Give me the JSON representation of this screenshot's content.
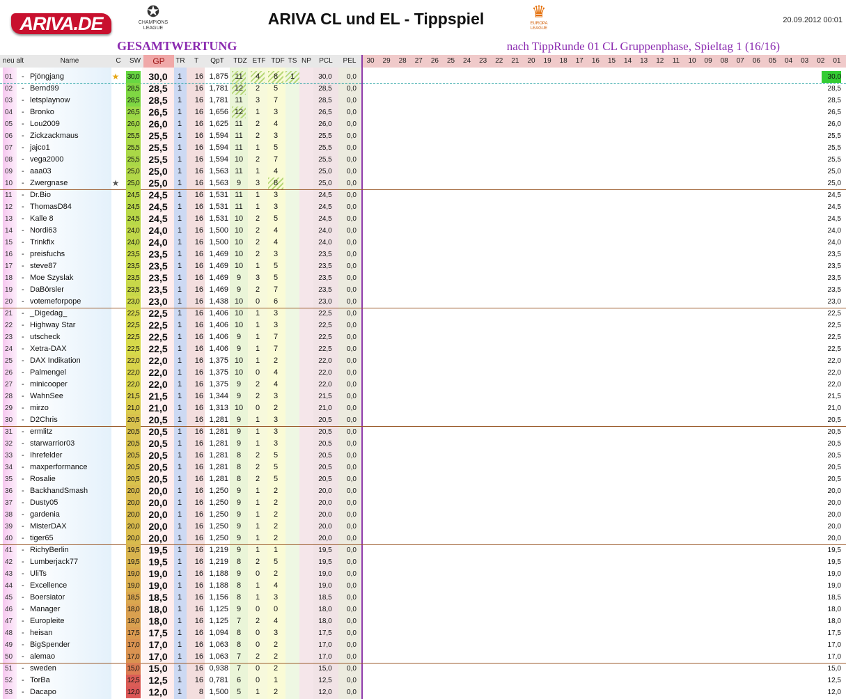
{
  "header": {
    "logo_text": "ARIVA.DE",
    "cl_logo_text": "CHAMPIONS LEAGUE",
    "el_logo_text": "EUROPA LEAGUE",
    "title": "ARIVA CL und EL - Tippspiel",
    "timestamp": "20.09.2012 00:01",
    "section": "GESAMTWERTUNG",
    "subtitle": "nach TippRunde 01 CL Gruppenphase, Spieltag 1 (16/16)"
  },
  "columns": {
    "neu_alt": "neu alt",
    "name": "Name",
    "c": "C",
    "sw": "SW",
    "gp": "GP",
    "tr": "TR",
    "t": "T",
    "qpt": "QpT",
    "tdz": "TDZ",
    "etf": "ETF",
    "tdf": "TDF",
    "ts": "TS",
    "np": "NP",
    "pcl": "PCL",
    "pel": "PEL",
    "rounds": [
      "30",
      "29",
      "28",
      "27",
      "26",
      "25",
      "24",
      "23",
      "22",
      "21",
      "20",
      "19",
      "18",
      "17",
      "16",
      "15",
      "14",
      "13",
      "12",
      "11",
      "10",
      "09",
      "08",
      "07",
      "06",
      "05",
      "04",
      "03",
      "02",
      "01"
    ]
  },
  "colors": {
    "accent_purple": "#8b2bb0",
    "logo_red": "#c8102e",
    "highlight_green": "#33cc33"
  },
  "rows": [
    {
      "rank": "01",
      "alt": "-",
      "name": "Pjöngjang",
      "star": "★",
      "sw": "30,0",
      "gp": "30,0",
      "tr": "1",
      "t": "16",
      "qpt": "1,875",
      "tdz": "11",
      "etf": "4",
      "tdf": "8",
      "ts": "1",
      "pcl": "30,0",
      "pel": "0,0",
      "r01": "30,0"
    },
    {
      "rank": "02",
      "alt": "-",
      "name": "Bernd99",
      "star": "",
      "sw": "28,5",
      "gp": "28,5",
      "tr": "1",
      "t": "16",
      "qpt": "1,781",
      "tdz": "12",
      "etf": "2",
      "tdf": "5",
      "ts": "",
      "pcl": "28,5",
      "pel": "0,0",
      "r01": "28,5"
    },
    {
      "rank": "03",
      "alt": "-",
      "name": "letsplaynow",
      "star": "",
      "sw": "28,5",
      "gp": "28,5",
      "tr": "1",
      "t": "16",
      "qpt": "1,781",
      "tdz": "11",
      "etf": "3",
      "tdf": "7",
      "ts": "",
      "pcl": "28,5",
      "pel": "0,0",
      "r01": "28,5"
    },
    {
      "rank": "04",
      "alt": "-",
      "name": "Bronko",
      "star": "",
      "sw": "26,5",
      "gp": "26,5",
      "tr": "1",
      "t": "16",
      "qpt": "1,656",
      "tdz": "12",
      "etf": "1",
      "tdf": "3",
      "ts": "",
      "pcl": "26,5",
      "pel": "0,0",
      "r01": "26,5"
    },
    {
      "rank": "05",
      "alt": "-",
      "name": "Lou2009",
      "star": "",
      "sw": "26,0",
      "gp": "26,0",
      "tr": "1",
      "t": "16",
      "qpt": "1,625",
      "tdz": "11",
      "etf": "2",
      "tdf": "4",
      "ts": "",
      "pcl": "26,0",
      "pel": "0,0",
      "r01": "26,0"
    },
    {
      "rank": "06",
      "alt": "-",
      "name": "Zickzackmaus",
      "star": "",
      "sw": "25,5",
      "gp": "25,5",
      "tr": "1",
      "t": "16",
      "qpt": "1,594",
      "tdz": "11",
      "etf": "2",
      "tdf": "3",
      "ts": "",
      "pcl": "25,5",
      "pel": "0,0",
      "r01": "25,5"
    },
    {
      "rank": "07",
      "alt": "-",
      "name": "jajco1",
      "star": "",
      "sw": "25,5",
      "gp": "25,5",
      "tr": "1",
      "t": "16",
      "qpt": "1,594",
      "tdz": "11",
      "etf": "1",
      "tdf": "5",
      "ts": "",
      "pcl": "25,5",
      "pel": "0,0",
      "r01": "25,5"
    },
    {
      "rank": "08",
      "alt": "-",
      "name": "vega2000",
      "star": "",
      "sw": "25,5",
      "gp": "25,5",
      "tr": "1",
      "t": "16",
      "qpt": "1,594",
      "tdz": "10",
      "etf": "2",
      "tdf": "7",
      "ts": "",
      "pcl": "25,5",
      "pel": "0,0",
      "r01": "25,5"
    },
    {
      "rank": "09",
      "alt": "-",
      "name": "aaa03",
      "star": "",
      "sw": "25,0",
      "gp": "25,0",
      "tr": "1",
      "t": "16",
      "qpt": "1,563",
      "tdz": "11",
      "etf": "1",
      "tdf": "4",
      "ts": "",
      "pcl": "25,0",
      "pel": "0,0",
      "r01": "25,0"
    },
    {
      "rank": "10",
      "alt": "-",
      "name": "Zwergnase",
      "star": "★",
      "sw": "25,0",
      "gp": "25,0",
      "tr": "1",
      "t": "16",
      "qpt": "1,563",
      "tdz": "9",
      "etf": "3",
      "tdf": "8",
      "ts": "",
      "pcl": "25,0",
      "pel": "0,0",
      "r01": "25,0"
    },
    {
      "rank": "11",
      "alt": "-",
      "name": "Dr.Bio",
      "star": "",
      "sw": "24,5",
      "gp": "24,5",
      "tr": "1",
      "t": "16",
      "qpt": "1,531",
      "tdz": "11",
      "etf": "1",
      "tdf": "3",
      "ts": "",
      "pcl": "24,5",
      "pel": "0,0",
      "r01": "24,5"
    },
    {
      "rank": "12",
      "alt": "-",
      "name": "ThomasD84",
      "star": "",
      "sw": "24,5",
      "gp": "24,5",
      "tr": "1",
      "t": "16",
      "qpt": "1,531",
      "tdz": "11",
      "etf": "1",
      "tdf": "3",
      "ts": "",
      "pcl": "24,5",
      "pel": "0,0",
      "r01": "24,5"
    },
    {
      "rank": "13",
      "alt": "-",
      "name": "Kalle 8",
      "star": "",
      "sw": "24,5",
      "gp": "24,5",
      "tr": "1",
      "t": "16",
      "qpt": "1,531",
      "tdz": "10",
      "etf": "2",
      "tdf": "5",
      "ts": "",
      "pcl": "24,5",
      "pel": "0,0",
      "r01": "24,5"
    },
    {
      "rank": "14",
      "alt": "-",
      "name": "Nordi63",
      "star": "",
      "sw": "24,0",
      "gp": "24,0",
      "tr": "1",
      "t": "16",
      "qpt": "1,500",
      "tdz": "10",
      "etf": "2",
      "tdf": "4",
      "ts": "",
      "pcl": "24,0",
      "pel": "0,0",
      "r01": "24,0"
    },
    {
      "rank": "15",
      "alt": "-",
      "name": "Trinkfix",
      "star": "",
      "sw": "24,0",
      "gp": "24,0",
      "tr": "1",
      "t": "16",
      "qpt": "1,500",
      "tdz": "10",
      "etf": "2",
      "tdf": "4",
      "ts": "",
      "pcl": "24,0",
      "pel": "0,0",
      "r01": "24,0"
    },
    {
      "rank": "16",
      "alt": "-",
      "name": "preisfuchs",
      "star": "",
      "sw": "23,5",
      "gp": "23,5",
      "tr": "1",
      "t": "16",
      "qpt": "1,469",
      "tdz": "10",
      "etf": "2",
      "tdf": "3",
      "ts": "",
      "pcl": "23,5",
      "pel": "0,0",
      "r01": "23,5"
    },
    {
      "rank": "17",
      "alt": "-",
      "name": "steve87",
      "star": "",
      "sw": "23,5",
      "gp": "23,5",
      "tr": "1",
      "t": "16",
      "qpt": "1,469",
      "tdz": "10",
      "etf": "1",
      "tdf": "5",
      "ts": "",
      "pcl": "23,5",
      "pel": "0,0",
      "r01": "23,5"
    },
    {
      "rank": "18",
      "alt": "-",
      "name": "Moe Szyslak",
      "star": "",
      "sw": "23,5",
      "gp": "23,5",
      "tr": "1",
      "t": "16",
      "qpt": "1,469",
      "tdz": "9",
      "etf": "3",
      "tdf": "5",
      "ts": "",
      "pcl": "23,5",
      "pel": "0,0",
      "r01": "23,5"
    },
    {
      "rank": "19",
      "alt": "-",
      "name": "DaBörsler",
      "star": "",
      "sw": "23,5",
      "gp": "23,5",
      "tr": "1",
      "t": "16",
      "qpt": "1,469",
      "tdz": "9",
      "etf": "2",
      "tdf": "7",
      "ts": "",
      "pcl": "23,5",
      "pel": "0,0",
      "r01": "23,5"
    },
    {
      "rank": "20",
      "alt": "-",
      "name": "votemeforpope",
      "star": "",
      "sw": "23,0",
      "gp": "23,0",
      "tr": "1",
      "t": "16",
      "qpt": "1,438",
      "tdz": "10",
      "etf": "0",
      "tdf": "6",
      "ts": "",
      "pcl": "23,0",
      "pel": "0,0",
      "r01": "23,0"
    },
    {
      "rank": "21",
      "alt": "-",
      "name": "_Digedag_",
      "star": "",
      "sw": "22,5",
      "gp": "22,5",
      "tr": "1",
      "t": "16",
      "qpt": "1,406",
      "tdz": "10",
      "etf": "1",
      "tdf": "3",
      "ts": "",
      "pcl": "22,5",
      "pel": "0,0",
      "r01": "22,5"
    },
    {
      "rank": "22",
      "alt": "-",
      "name": "Highway Star",
      "star": "",
      "sw": "22,5",
      "gp": "22,5",
      "tr": "1",
      "t": "16",
      "qpt": "1,406",
      "tdz": "10",
      "etf": "1",
      "tdf": "3",
      "ts": "",
      "pcl": "22,5",
      "pel": "0,0",
      "r01": "22,5"
    },
    {
      "rank": "23",
      "alt": "-",
      "name": "utscheck",
      "star": "",
      "sw": "22,5",
      "gp": "22,5",
      "tr": "1",
      "t": "16",
      "qpt": "1,406",
      "tdz": "9",
      "etf": "1",
      "tdf": "7",
      "ts": "",
      "pcl": "22,5",
      "pel": "0,0",
      "r01": "22,5"
    },
    {
      "rank": "24",
      "alt": "-",
      "name": "Xetra-DAX",
      "star": "",
      "sw": "22,5",
      "gp": "22,5",
      "tr": "1",
      "t": "16",
      "qpt": "1,406",
      "tdz": "9",
      "etf": "1",
      "tdf": "7",
      "ts": "",
      "pcl": "22,5",
      "pel": "0,0",
      "r01": "22,5"
    },
    {
      "rank": "25",
      "alt": "-",
      "name": "DAX Indikation",
      "star": "",
      "sw": "22,0",
      "gp": "22,0",
      "tr": "1",
      "t": "16",
      "qpt": "1,375",
      "tdz": "10",
      "etf": "1",
      "tdf": "2",
      "ts": "",
      "pcl": "22,0",
      "pel": "0,0",
      "r01": "22,0"
    },
    {
      "rank": "26",
      "alt": "-",
      "name": "Palmengel",
      "star": "",
      "sw": "22,0",
      "gp": "22,0",
      "tr": "1",
      "t": "16",
      "qpt": "1,375",
      "tdz": "10",
      "etf": "0",
      "tdf": "4",
      "ts": "",
      "pcl": "22,0",
      "pel": "0,0",
      "r01": "22,0"
    },
    {
      "rank": "27",
      "alt": "-",
      "name": "minicooper",
      "star": "",
      "sw": "22,0",
      "gp": "22,0",
      "tr": "1",
      "t": "16",
      "qpt": "1,375",
      "tdz": "9",
      "etf": "2",
      "tdf": "4",
      "ts": "",
      "pcl": "22,0",
      "pel": "0,0",
      "r01": "22,0"
    },
    {
      "rank": "28",
      "alt": "-",
      "name": "WahnSee",
      "star": "",
      "sw": "21,5",
      "gp": "21,5",
      "tr": "1",
      "t": "16",
      "qpt": "1,344",
      "tdz": "9",
      "etf": "2",
      "tdf": "3",
      "ts": "",
      "pcl": "21,5",
      "pel": "0,0",
      "r01": "21,5"
    },
    {
      "rank": "29",
      "alt": "-",
      "name": "mirzo",
      "star": "",
      "sw": "21,0",
      "gp": "21,0",
      "tr": "1",
      "t": "16",
      "qpt": "1,313",
      "tdz": "10",
      "etf": "0",
      "tdf": "2",
      "ts": "",
      "pcl": "21,0",
      "pel": "0,0",
      "r01": "21,0"
    },
    {
      "rank": "30",
      "alt": "-",
      "name": "D2Chris",
      "star": "",
      "sw": "20,5",
      "gp": "20,5",
      "tr": "1",
      "t": "16",
      "qpt": "1,281",
      "tdz": "9",
      "etf": "1",
      "tdf": "3",
      "ts": "",
      "pcl": "20,5",
      "pel": "0,0",
      "r01": "20,5"
    },
    {
      "rank": "31",
      "alt": "-",
      "name": "ermlitz",
      "star": "",
      "sw": "20,5",
      "gp": "20,5",
      "tr": "1",
      "t": "16",
      "qpt": "1,281",
      "tdz": "9",
      "etf": "1",
      "tdf": "3",
      "ts": "",
      "pcl": "20,5",
      "pel": "0,0",
      "r01": "20,5"
    },
    {
      "rank": "32",
      "alt": "-",
      "name": "starwarrior03",
      "star": "",
      "sw": "20,5",
      "gp": "20,5",
      "tr": "1",
      "t": "16",
      "qpt": "1,281",
      "tdz": "9",
      "etf": "1",
      "tdf": "3",
      "ts": "",
      "pcl": "20,5",
      "pel": "0,0",
      "r01": "20,5"
    },
    {
      "rank": "33",
      "alt": "-",
      "name": "Ihrefelder",
      "star": "",
      "sw": "20,5",
      "gp": "20,5",
      "tr": "1",
      "t": "16",
      "qpt": "1,281",
      "tdz": "8",
      "etf": "2",
      "tdf": "5",
      "ts": "",
      "pcl": "20,5",
      "pel": "0,0",
      "r01": "20,5"
    },
    {
      "rank": "34",
      "alt": "-",
      "name": "maxperformance",
      "star": "",
      "sw": "20,5",
      "gp": "20,5",
      "tr": "1",
      "t": "16",
      "qpt": "1,281",
      "tdz": "8",
      "etf": "2",
      "tdf": "5",
      "ts": "",
      "pcl": "20,5",
      "pel": "0,0",
      "r01": "20,5"
    },
    {
      "rank": "35",
      "alt": "-",
      "name": "Rosalie",
      "star": "",
      "sw": "20,5",
      "gp": "20,5",
      "tr": "1",
      "t": "16",
      "qpt": "1,281",
      "tdz": "8",
      "etf": "2",
      "tdf": "5",
      "ts": "",
      "pcl": "20,5",
      "pel": "0,0",
      "r01": "20,5"
    },
    {
      "rank": "36",
      "alt": "-",
      "name": "BackhandSmash",
      "star": "",
      "sw": "20,0",
      "gp": "20,0",
      "tr": "1",
      "t": "16",
      "qpt": "1,250",
      "tdz": "9",
      "etf": "1",
      "tdf": "2",
      "ts": "",
      "pcl": "20,0",
      "pel": "0,0",
      "r01": "20,0"
    },
    {
      "rank": "37",
      "alt": "-",
      "name": "Dusty05",
      "star": "",
      "sw": "20,0",
      "gp": "20,0",
      "tr": "1",
      "t": "16",
      "qpt": "1,250",
      "tdz": "9",
      "etf": "1",
      "tdf": "2",
      "ts": "",
      "pcl": "20,0",
      "pel": "0,0",
      "r01": "20,0"
    },
    {
      "rank": "38",
      "alt": "-",
      "name": "gardenia",
      "star": "",
      "sw": "20,0",
      "gp": "20,0",
      "tr": "1",
      "t": "16",
      "qpt": "1,250",
      "tdz": "9",
      "etf": "1",
      "tdf": "2",
      "ts": "",
      "pcl": "20,0",
      "pel": "0,0",
      "r01": "20,0"
    },
    {
      "rank": "39",
      "alt": "-",
      "name": "MisterDAX",
      "star": "",
      "sw": "20,0",
      "gp": "20,0",
      "tr": "1",
      "t": "16",
      "qpt": "1,250",
      "tdz": "9",
      "etf": "1",
      "tdf": "2",
      "ts": "",
      "pcl": "20,0",
      "pel": "0,0",
      "r01": "20,0"
    },
    {
      "rank": "40",
      "alt": "-",
      "name": "tiger65",
      "star": "",
      "sw": "20,0",
      "gp": "20,0",
      "tr": "1",
      "t": "16",
      "qpt": "1,250",
      "tdz": "9",
      "etf": "1",
      "tdf": "2",
      "ts": "",
      "pcl": "20,0",
      "pel": "0,0",
      "r01": "20,0"
    },
    {
      "rank": "41",
      "alt": "-",
      "name": "RichyBerlin",
      "star": "",
      "sw": "19,5",
      "gp": "19,5",
      "tr": "1",
      "t": "16",
      "qpt": "1,219",
      "tdz": "9",
      "etf": "1",
      "tdf": "1",
      "ts": "",
      "pcl": "19,5",
      "pel": "0,0",
      "r01": "19,5"
    },
    {
      "rank": "42",
      "alt": "-",
      "name": "Lumberjack77",
      "star": "",
      "sw": "19,5",
      "gp": "19,5",
      "tr": "1",
      "t": "16",
      "qpt": "1,219",
      "tdz": "8",
      "etf": "2",
      "tdf": "5",
      "ts": "",
      "pcl": "19,5",
      "pel": "0,0",
      "r01": "19,5"
    },
    {
      "rank": "43",
      "alt": "-",
      "name": "UliTs",
      "star": "",
      "sw": "19,0",
      "gp": "19,0",
      "tr": "1",
      "t": "16",
      "qpt": "1,188",
      "tdz": "9",
      "etf": "0",
      "tdf": "2",
      "ts": "",
      "pcl": "19,0",
      "pel": "0,0",
      "r01": "19,0"
    },
    {
      "rank": "44",
      "alt": "-",
      "name": "Excellence",
      "star": "",
      "sw": "19,0",
      "gp": "19,0",
      "tr": "1",
      "t": "16",
      "qpt": "1,188",
      "tdz": "8",
      "etf": "1",
      "tdf": "4",
      "ts": "",
      "pcl": "19,0",
      "pel": "0,0",
      "r01": "19,0"
    },
    {
      "rank": "45",
      "alt": "-",
      "name": "Boersiator",
      "star": "",
      "sw": "18,5",
      "gp": "18,5",
      "tr": "1",
      "t": "16",
      "qpt": "1,156",
      "tdz": "8",
      "etf": "1",
      "tdf": "3",
      "ts": "",
      "pcl": "18,5",
      "pel": "0,0",
      "r01": "18,5"
    },
    {
      "rank": "46",
      "alt": "-",
      "name": "Manager",
      "star": "",
      "sw": "18,0",
      "gp": "18,0",
      "tr": "1",
      "t": "16",
      "qpt": "1,125",
      "tdz": "9",
      "etf": "0",
      "tdf": "0",
      "ts": "",
      "pcl": "18,0",
      "pel": "0,0",
      "r01": "18,0"
    },
    {
      "rank": "47",
      "alt": "-",
      "name": "Europleite",
      "star": "",
      "sw": "18,0",
      "gp": "18,0",
      "tr": "1",
      "t": "16",
      "qpt": "1,125",
      "tdz": "7",
      "etf": "2",
      "tdf": "4",
      "ts": "",
      "pcl": "18,0",
      "pel": "0,0",
      "r01": "18,0"
    },
    {
      "rank": "48",
      "alt": "-",
      "name": "heisan",
      "star": "",
      "sw": "17,5",
      "gp": "17,5",
      "tr": "1",
      "t": "16",
      "qpt": "1,094",
      "tdz": "8",
      "etf": "0",
      "tdf": "3",
      "ts": "",
      "pcl": "17,5",
      "pel": "0,0",
      "r01": "17,5"
    },
    {
      "rank": "49",
      "alt": "-",
      "name": "BigSpender",
      "star": "",
      "sw": "17,0",
      "gp": "17,0",
      "tr": "1",
      "t": "16",
      "qpt": "1,063",
      "tdz": "8",
      "etf": "0",
      "tdf": "2",
      "ts": "",
      "pcl": "17,0",
      "pel": "0,0",
      "r01": "17,0"
    },
    {
      "rank": "50",
      "alt": "-",
      "name": "alemao",
      "star": "",
      "sw": "17,0",
      "gp": "17,0",
      "tr": "1",
      "t": "16",
      "qpt": "1,063",
      "tdz": "7",
      "etf": "2",
      "tdf": "2",
      "ts": "",
      "pcl": "17,0",
      "pel": "0,0",
      "r01": "17,0"
    },
    {
      "rank": "51",
      "alt": "-",
      "name": "sweden",
      "star": "",
      "sw": "15,0",
      "gp": "15,0",
      "tr": "1",
      "t": "16",
      "qpt": "0,938",
      "tdz": "7",
      "etf": "0",
      "tdf": "2",
      "ts": "",
      "pcl": "15,0",
      "pel": "0,0",
      "r01": "15,0"
    },
    {
      "rank": "52",
      "alt": "-",
      "name": "TorBa",
      "star": "",
      "sw": "12,5",
      "gp": "12,5",
      "tr": "1",
      "t": "16",
      "qpt": "0,781",
      "tdz": "6",
      "etf": "0",
      "tdf": "1",
      "ts": "",
      "pcl": "12,5",
      "pel": "0,0",
      "r01": "12,5"
    },
    {
      "rank": "53",
      "alt": "-",
      "name": "Dacapo",
      "star": "",
      "sw": "12,0",
      "gp": "12,0",
      "tr": "1",
      "t": "8",
      "qpt": "1,500",
      "tdz": "5",
      "etf": "1",
      "tdf": "2",
      "ts": "",
      "pcl": "12,0",
      "pel": "0,0",
      "r01": "12,0"
    }
  ]
}
